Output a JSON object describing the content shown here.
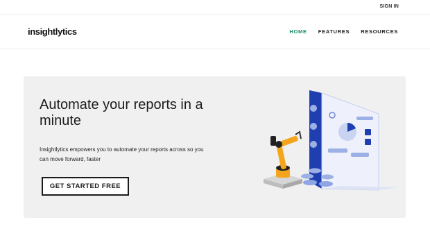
{
  "header": {
    "sign_in": "SIGN IN"
  },
  "nav": {
    "logo": "insightlytics",
    "items": [
      {
        "label": "HOME",
        "active": true
      },
      {
        "label": "FEATURES",
        "active": false
      },
      {
        "label": "RESOURCES",
        "active": false
      }
    ]
  },
  "hero": {
    "title": "Automate your reports in a minute",
    "description": "Insightlytics empowers you to automate your reports across so you can move forward, faster",
    "cta_label": "GET STARTED FREE"
  },
  "colors": {
    "accent": "#1a8c6a",
    "hero_bg": "#f0f0f1",
    "robot": "#f4a51c",
    "dashboard": "#1f3fb0"
  }
}
